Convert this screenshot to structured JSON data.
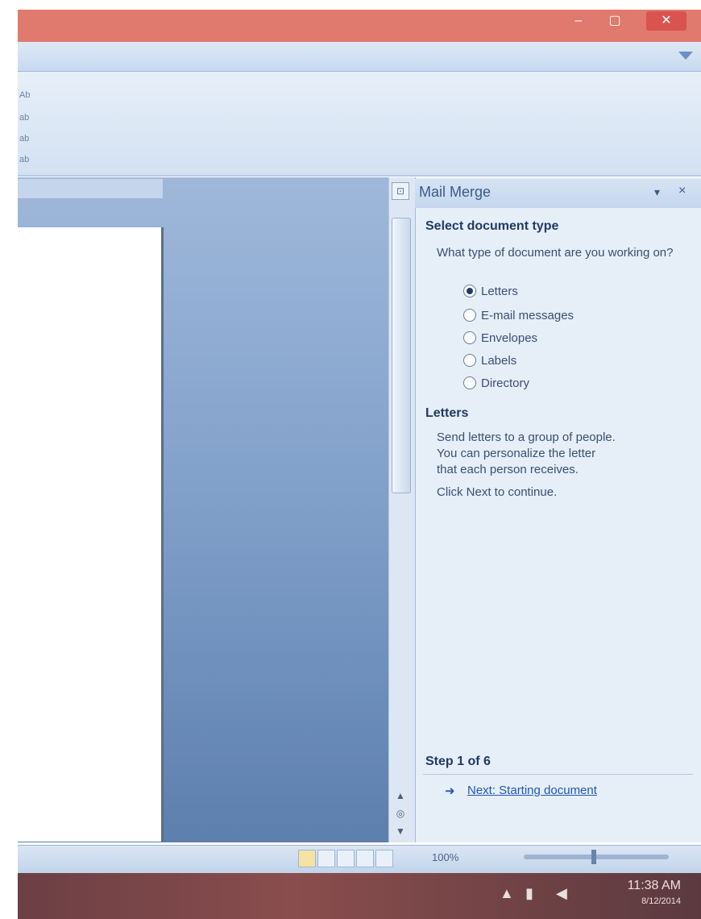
{
  "window": {
    "minimize_glyph": "–",
    "maximize_glyph": "▢",
    "close_glyph": "✕"
  },
  "ribbon": {
    "small_labels": [
      "Ab",
      "ab",
      "ab",
      "ab"
    ]
  },
  "task_pane": {
    "title": "Mail Merge",
    "menu_glyph": "▾",
    "close_glyph": "×",
    "section_heading": "Select document type",
    "section_prompt": "What type of document are you working on?",
    "options": [
      {
        "label": "Letters",
        "checked": true
      },
      {
        "label": "E-mail messages",
        "checked": false
      },
      {
        "label": "Envelopes",
        "checked": false
      },
      {
        "label": "Labels",
        "checked": false
      },
      {
        "label": "Directory",
        "checked": false
      }
    ],
    "desc_heading": "Letters",
    "desc_text_1": "Send letters to a group of people.",
    "desc_text_2": "You can personalize the letter",
    "desc_text_3": "that each person receives.",
    "desc_text_4": "Click Next to continue.",
    "step_label": "Step 1 of 6",
    "next_link": "Next: Starting document",
    "next_arrow": "➜"
  },
  "scrollbar": {
    "ruler_toggle": "⊡",
    "prev_glyph": "▲",
    "select_glyph": "◎",
    "next_glyph": "▼"
  },
  "statusbar": {
    "zoom": "100%"
  },
  "taskbar": {
    "time": "11:38 AM",
    "date": "8/12/2014"
  },
  "colors": {
    "titlebar": "#e07a6e",
    "accent": "#2257b5",
    "taskbar": "#7a4548"
  }
}
